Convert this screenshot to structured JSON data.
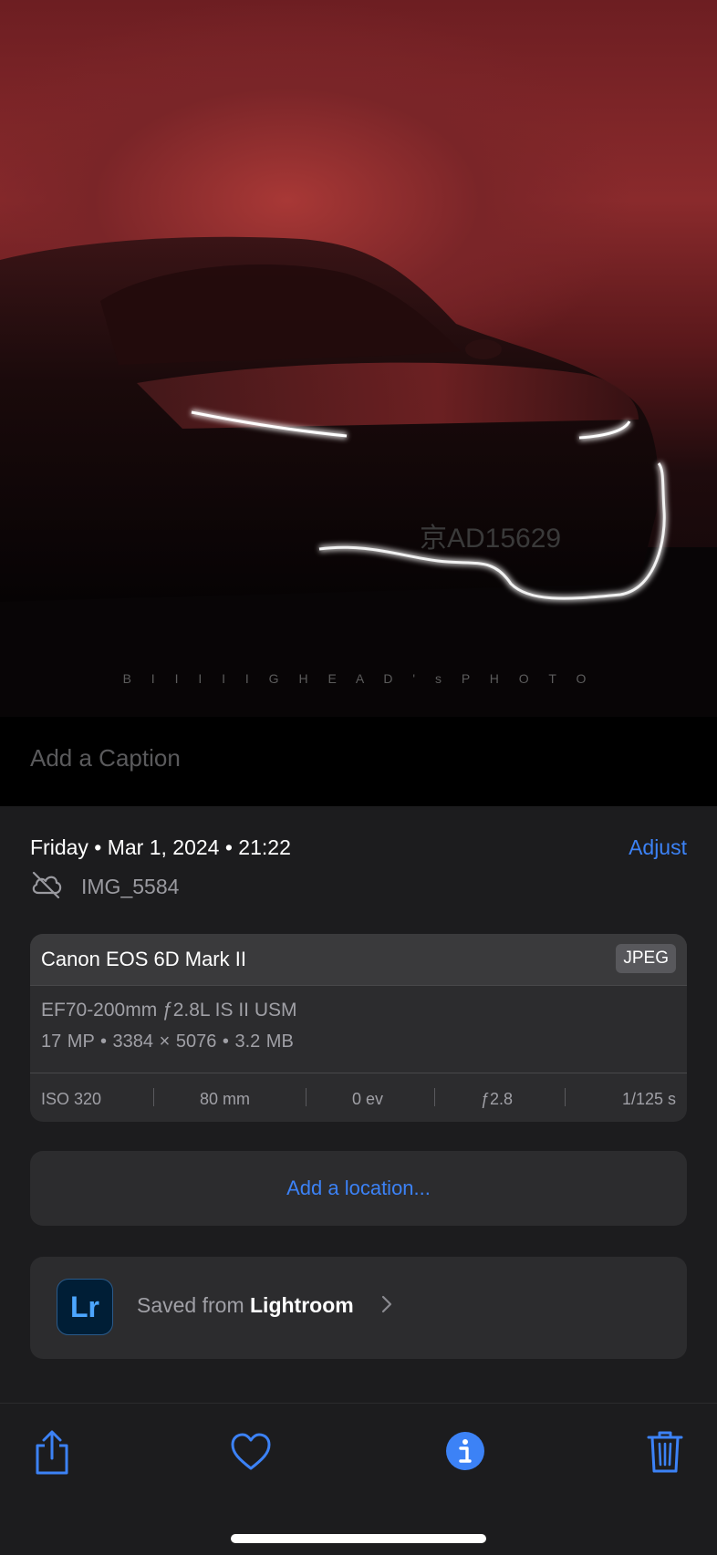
{
  "photo": {
    "watermark": "B I I I I I G H E A D ' s   P H O T O",
    "plate_text": "京AD15629"
  },
  "caption": {
    "placeholder": "Add a Caption"
  },
  "info": {
    "date_line": "Friday • Mar 1, 2024 • 21:22",
    "adjust_label": "Adjust",
    "file_name": "IMG_5584",
    "camera": {
      "model": "Canon EOS 6D Mark II",
      "format": "JPEG",
      "lens": "EF70-200mm ƒ2.8L IS II USM",
      "specs": "17 MP  •  3384 × 5076  •  3.2 MB",
      "exif": {
        "iso": "ISO 320",
        "focal": "80 mm",
        "ev": "0 ev",
        "aperture": "ƒ2.8",
        "shutter": "1/125 s"
      }
    },
    "location_label": "Add a location...",
    "source": {
      "logo": "Lr",
      "prefix": "Saved from",
      "app": "Lightroom"
    }
  },
  "toolbar": {
    "icons": [
      "share-icon",
      "heart-icon",
      "info-icon",
      "trash-icon"
    ],
    "accent": "#3c82f6"
  },
  "colors": {
    "accent": "#3c82f6",
    "panel": "#1c1c1e",
    "card": "#2c2c2e"
  }
}
